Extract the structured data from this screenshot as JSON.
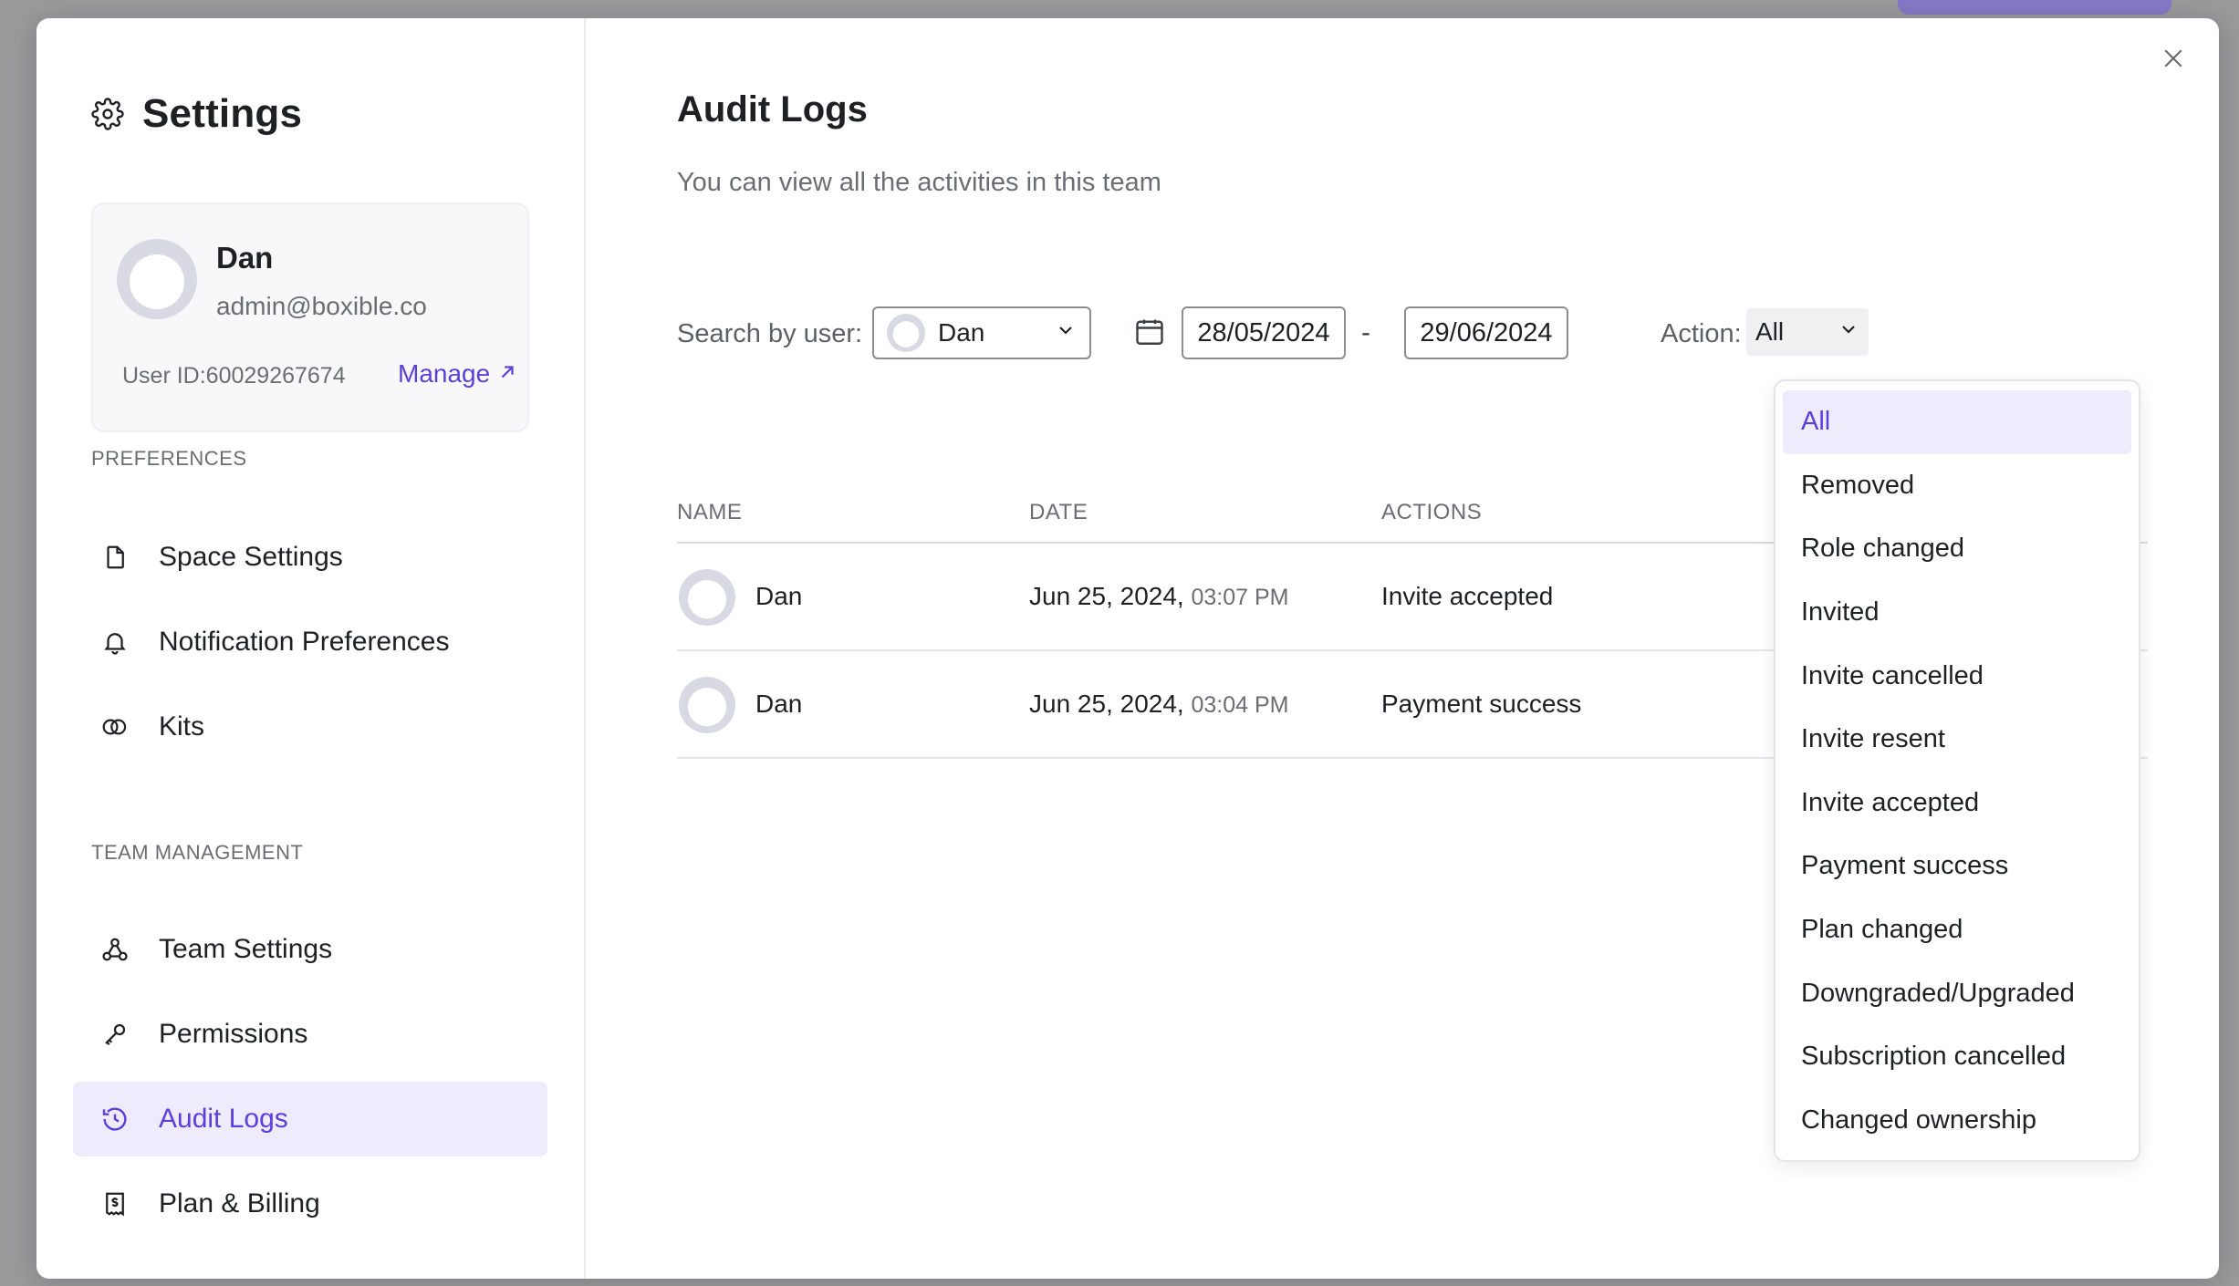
{
  "sidebar": {
    "title": "Settings",
    "profile": {
      "name": "Dan",
      "email": "admin@boxible.co",
      "user_id": "User ID:60029267674",
      "manage_label": "Manage"
    },
    "preferences_label": "PREFERENCES",
    "preferences_items": [
      {
        "label": "Space Settings",
        "icon": "file-icon"
      },
      {
        "label": "Notification Preferences",
        "icon": "bell-icon"
      },
      {
        "label": "Kits",
        "icon": "kits-icon"
      }
    ],
    "team_label": "TEAM MANAGEMENT",
    "team_items": [
      {
        "label": "Team Settings",
        "icon": "team-icon"
      },
      {
        "label": "Permissions",
        "icon": "key-icon"
      },
      {
        "label": "Audit Logs",
        "icon": "history-icon",
        "active": true
      },
      {
        "label": "Plan & Billing",
        "icon": "billing-icon"
      }
    ]
  },
  "main": {
    "title": "Audit Logs",
    "subtitle": "You can view all the activities in this team",
    "filters": {
      "search_label": "Search by user:",
      "selected_user": "Dan",
      "date_from": "28/05/2024",
      "date_separator": "-",
      "date_to": "29/06/2024",
      "action_label": "Action:",
      "action_value": "All"
    },
    "table": {
      "headers": [
        "NAME",
        "DATE",
        "ACTIONS"
      ],
      "rows": [
        {
          "name": "Dan",
          "date": "Jun 25, 2024,",
          "time": "03:07 PM",
          "action": "Invite accepted"
        },
        {
          "name": "Dan",
          "date": "Jun 25, 2024,",
          "time": "03:04 PM",
          "action": "Payment success"
        }
      ]
    },
    "action_options": [
      "All",
      "Removed",
      "Role changed",
      "Invited",
      "Invite cancelled",
      "Invite resent",
      "Invite accepted",
      "Payment success",
      "Plan changed",
      "Downgraded/Upgraded",
      "Subscription cancelled",
      "Changed ownership"
    ]
  },
  "colors": {
    "accent": "#5b3fd9",
    "active_bg": "#eeebfc",
    "muted_text": "#6b6d73"
  }
}
